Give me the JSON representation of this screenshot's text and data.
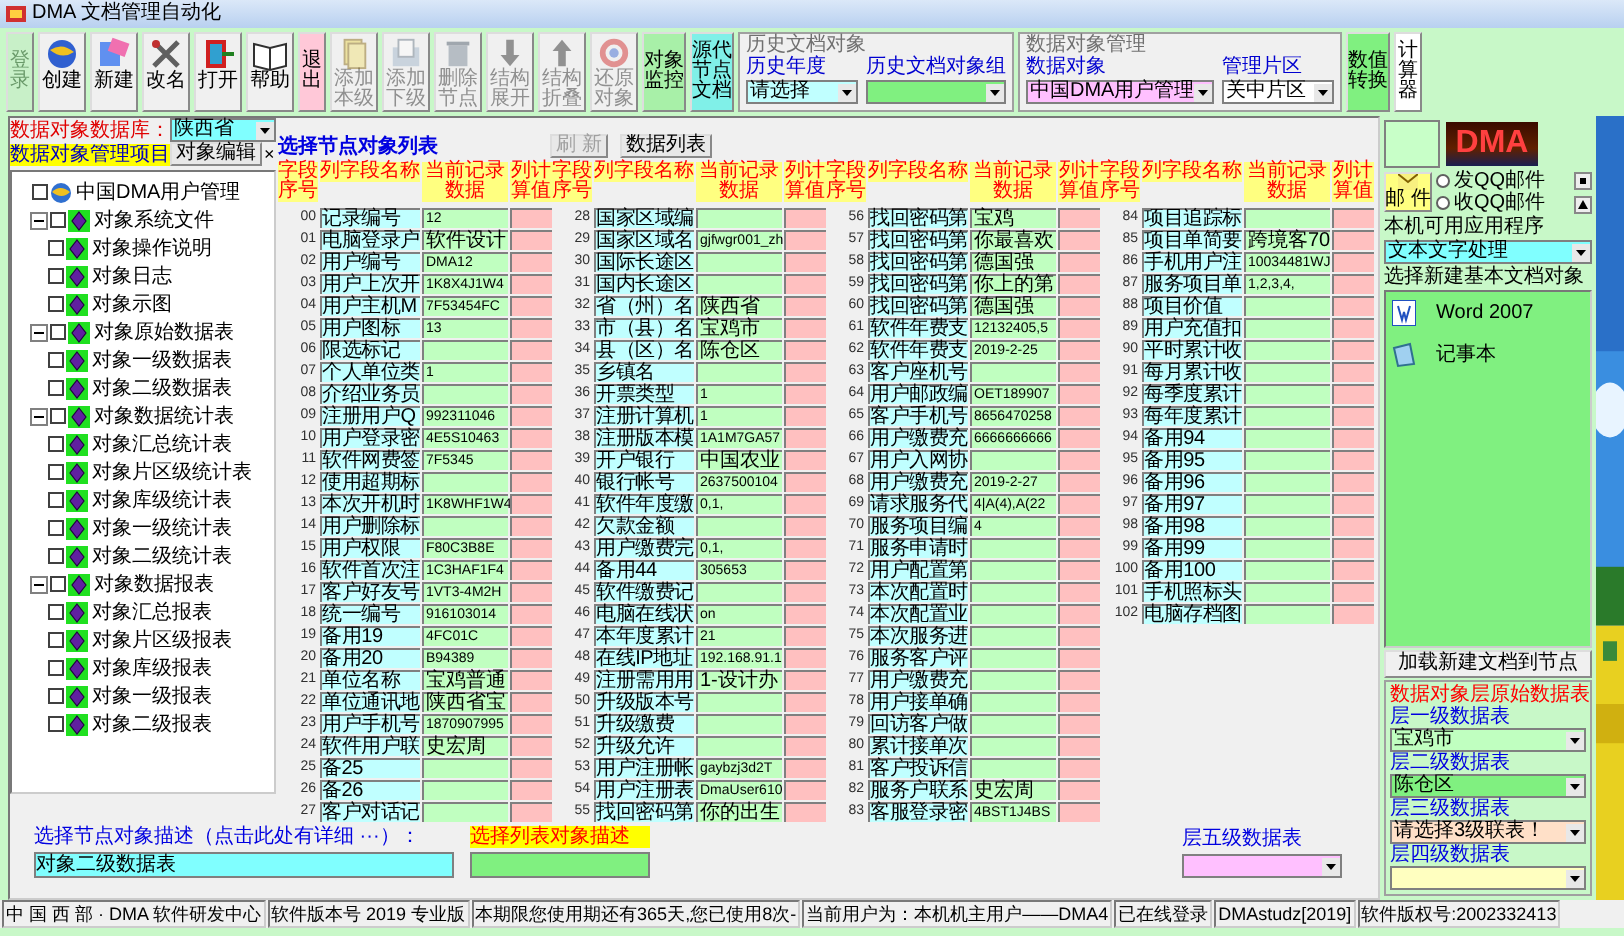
{
  "window": {
    "title": "DMA 文档管理自动化"
  },
  "toolbar": [
    {
      "kind": "tile",
      "label": "登录",
      "disabled": true,
      "color": "#c8f0c8"
    },
    {
      "kind": "icon",
      "label": "创建",
      "disabled": false
    },
    {
      "kind": "icon",
      "label": "新建",
      "disabled": false
    },
    {
      "kind": "icon",
      "label": "改名",
      "disabled": false
    },
    {
      "kind": "icon",
      "label": "打开",
      "disabled": false
    },
    {
      "kind": "icon",
      "label": "帮助",
      "disabled": false
    },
    {
      "kind": "tile",
      "label": "退出",
      "disabled": false,
      "color": "#ffc8d8"
    },
    {
      "kind": "icon",
      "label": "添加本级",
      "disabled": true
    },
    {
      "kind": "icon",
      "label": "添加下级",
      "disabled": true
    },
    {
      "kind": "icon",
      "label": "删除节点",
      "disabled": true
    },
    {
      "kind": "icon",
      "label": "结构展开",
      "disabled": true
    },
    {
      "kind": "icon",
      "label": "结构折叠",
      "disabled": true
    },
    {
      "kind": "icon",
      "label": "还原对象",
      "disabled": true
    },
    {
      "kind": "tile",
      "label": "对象监控",
      "disabled": false,
      "color": "#a8f0a8"
    },
    {
      "kind": "tile",
      "label": "源代节点文档",
      "disabled": false,
      "color": "#80f0e8"
    },
    {
      "kind": "group",
      "title": "历史文档对象",
      "fields": [
        {
          "label": "历史年度",
          "value": "请选择",
          "color": "#c0ffff"
        },
        {
          "label": "历史文档对象组",
          "color": "#80f080"
        }
      ]
    },
    {
      "kind": "group",
      "title": "数据对象管理",
      "fields": [
        {
          "label": "数据对象",
          "value": "中国DMA用户管理",
          "color": "#ffc0ff"
        },
        {
          "label": "管理片区",
          "value": "关中片区",
          "color": "#ffffff"
        }
      ]
    },
    {
      "kind": "tile",
      "label": "数值转换",
      "disabled": false,
      "color": "#80f080"
    },
    {
      "kind": "tile",
      "label": "计算器",
      "disabled": false,
      "color": "#ffffff"
    }
  ],
  "left": {
    "database_label": "数据对象数据库：",
    "database": "陕西省",
    "project_label": "数据对象管理项目",
    "edit_button": "对象编辑",
    "close_button": "×",
    "tree": {
      "label": "中国DMA用户管理",
      "checked": false,
      "children": [
        {
          "label": "对象系统文件",
          "checked": false,
          "expanded": true,
          "children": [
            {
              "label": "对象操作说明",
              "checked": false
            },
            {
              "label": "对象日志",
              "checked": false
            },
            {
              "label": "对象示图",
              "checked": false
            }
          ]
        },
        {
          "label": "对象原始数据表",
          "checked": false,
          "expanded": true,
          "children": [
            {
              "label": "对象一级数据表",
              "checked": false
            },
            {
              "label": "对象二级数据表",
              "checked": false
            }
          ]
        },
        {
          "label": "对象数据统计表",
          "checked": false,
          "expanded": true,
          "children": [
            {
              "label": "对象汇总统计表",
              "checked": false
            },
            {
              "label": "对象片区级统计表",
              "checked": false
            },
            {
              "label": "对象库级统计表",
              "checked": false
            },
            {
              "label": "对象一级统计表",
              "checked": false
            },
            {
              "label": "对象二级统计表",
              "checked": false
            }
          ]
        },
        {
          "label": "对象数据报表",
          "checked": false,
          "expanded": true,
          "children": [
            {
              "label": "对象汇总报表",
              "checked": false
            },
            {
              "label": "对象片区级报表",
              "checked": false
            },
            {
              "label": "对象库级报表",
              "checked": false
            },
            {
              "label": "对象一级报表",
              "checked": false
            },
            {
              "label": "对象二级报表",
              "checked": false
            }
          ]
        }
      ]
    }
  },
  "table": {
    "title": "选择节点对象列表",
    "refresh_button": {
      "label": "刷 新",
      "disabled": true
    },
    "list_button": "数据列表",
    "groups": [
      {
        "headers": [
          "字段序号",
          "列字段名称",
          "当前记录数据",
          "列计算值"
        ],
        "rows": [
          {
            "no": "00",
            "name": "记录编号",
            "value": "12"
          },
          {
            "no": "01",
            "name": "电脑登录户",
            "value": "软件设计"
          },
          {
            "no": "02",
            "name": "用户编号",
            "value": "DMA12"
          },
          {
            "no": "03",
            "name": "用户上次开",
            "value": "1K8X4J1W4"
          },
          {
            "no": "04",
            "name": "用户主机M",
            "value": "7F53454FC"
          },
          {
            "no": "05",
            "name": "用户图标",
            "value": "13"
          },
          {
            "no": "06",
            "name": "限选标记"
          },
          {
            "no": "07",
            "name": "个人单位类",
            "value": "1"
          },
          {
            "no": "08",
            "name": "介绍业务员"
          },
          {
            "no": "09",
            "name": "注册用户Q",
            "value": "992311046"
          },
          {
            "no": "10",
            "name": "用户登录密",
            "value": "4E5S10463"
          },
          {
            "no": "11",
            "name": "软件网费签",
            "value": "7F5345"
          },
          {
            "no": "12",
            "name": "使用超期标"
          },
          {
            "no": "13",
            "name": "本次开机时",
            "value": "1K8WHF1W4"
          },
          {
            "no": "14",
            "name": "用户删除标"
          },
          {
            "no": "15",
            "name": "用户权限",
            "value": "F80C3B8E"
          },
          {
            "no": "16",
            "name": "软件首次注",
            "value": "1C3HAF1F4"
          },
          {
            "no": "17",
            "name": "客户好友号",
            "value": "1VT3-4M2H"
          },
          {
            "no": "18",
            "name": "统一编号",
            "value": "916103014"
          },
          {
            "no": "19",
            "name": "备用19",
            "value": "4FC01C"
          },
          {
            "no": "20",
            "name": "备用20",
            "value": "B94389"
          },
          {
            "no": "21",
            "name": "单位名称",
            "value": "宝鸡普通"
          },
          {
            "no": "22",
            "name": "单位通讯地",
            "value": "陕西省宝"
          },
          {
            "no": "23",
            "name": "用户手机号",
            "value": "1870907995"
          },
          {
            "no": "24",
            "name": "软件用户联",
            "value": "史宏周"
          },
          {
            "no": "25",
            "name": "备25"
          },
          {
            "no": "26",
            "name": "备26"
          },
          {
            "no": "27",
            "name": "客户对话记"
          }
        ]
      },
      {
        "headers": [
          "字段序号",
          "列字段名称",
          "当前记录数据",
          "列计算值"
        ],
        "rows": [
          {
            "no": "28",
            "name": "国家区域编"
          },
          {
            "no": "29",
            "name": "国家区域名",
            "value": "gjfwgr001_zh"
          },
          {
            "no": "30",
            "name": "国际长途区"
          },
          {
            "no": "31",
            "name": "国内长途区"
          },
          {
            "no": "32",
            "name": "省（州）名",
            "value": "陕西省"
          },
          {
            "no": "33",
            "name": "市（县）名",
            "value": "宝鸡市"
          },
          {
            "no": "34",
            "name": "县（区）名",
            "value": "陈仓区"
          },
          {
            "no": "35",
            "name": "乡镇名"
          },
          {
            "no": "36",
            "name": "开票类型",
            "value": "1"
          },
          {
            "no": "37",
            "name": "注册计算机",
            "value": "1"
          },
          {
            "no": "38",
            "name": "注册版本模",
            "value": "1A1M7GA57"
          },
          {
            "no": "39",
            "name": "开户银行",
            "value": "中国农业"
          },
          {
            "no": "40",
            "name": "银行帐号",
            "value": "2637500104"
          },
          {
            "no": "41",
            "name": "软件年度缴",
            "value": "0,1,"
          },
          {
            "no": "42",
            "name": "欠款金额"
          },
          {
            "no": "43",
            "name": "用户缴费完",
            "value": "0,1,"
          },
          {
            "no": "44",
            "name": "备用44",
            "value": "305653"
          },
          {
            "no": "45",
            "name": "软件缴费记"
          },
          {
            "no": "46",
            "name": "电脑在线状",
            "value": "on"
          },
          {
            "no": "47",
            "name": "本年度累计",
            "value": "21"
          },
          {
            "no": "48",
            "name": "在线IP地址",
            "value": "192.168.91.1"
          },
          {
            "no": "49",
            "name": "注册需用用",
            "value": "1-设计办"
          },
          {
            "no": "50",
            "name": "升级版本号"
          },
          {
            "no": "51",
            "name": "升级缴费"
          },
          {
            "no": "52",
            "name": "升级允许"
          },
          {
            "no": "53",
            "name": "用户注册帐",
            "value": "gaybzj3d2T"
          },
          {
            "no": "54",
            "name": "用户注册表",
            "value": "DmaUser610"
          },
          {
            "no": "55",
            "name": "找回密码第",
            "value": "你的出生"
          }
        ]
      },
      {
        "headers": [
          "字段序号",
          "列字段名称",
          "当前记录数据",
          "列计算值"
        ],
        "rows": [
          {
            "no": "56",
            "name": "找回密码第",
            "value": "宝鸡"
          },
          {
            "no": "57",
            "name": "找回密码第",
            "value": "你最喜欢"
          },
          {
            "no": "58",
            "name": "找回密码第",
            "value": "德国强"
          },
          {
            "no": "59",
            "name": "找回密码第",
            "value": "你上的第"
          },
          {
            "no": "60",
            "name": "找回密码第",
            "value": "德国强"
          },
          {
            "no": "61",
            "name": "软件年费支",
            "value": "12132405,5"
          },
          {
            "no": "62",
            "name": "软件年费支",
            "value": "2019-2-25"
          },
          {
            "no": "63",
            "name": "客户座机号"
          },
          {
            "no": "64",
            "name": "用户邮政编",
            "value": "OET189907"
          },
          {
            "no": "65",
            "name": "客户手机号",
            "value": "8656470258"
          },
          {
            "no": "66",
            "name": "用户缴费充",
            "value": "6666666666"
          },
          {
            "no": "67",
            "name": "用户入网协"
          },
          {
            "no": "68",
            "name": "用户缴费充",
            "value": "2019-2-27"
          },
          {
            "no": "69",
            "name": "请求服务代",
            "value": "4|A(4),A(22"
          },
          {
            "no": "70",
            "name": "服务项目编",
            "value": "4"
          },
          {
            "no": "71",
            "name": "服务申请时"
          },
          {
            "no": "72",
            "name": "用户配置第"
          },
          {
            "no": "73",
            "name": "本次配置时"
          },
          {
            "no": "74",
            "name": "本次配置业"
          },
          {
            "no": "75",
            "name": "本次服务进"
          },
          {
            "no": "76",
            "name": "服务客户评"
          },
          {
            "no": "77",
            "name": "用户缴费充"
          },
          {
            "no": "78",
            "name": "用户接单确"
          },
          {
            "no": "79",
            "name": "回访客户做"
          },
          {
            "no": "80",
            "name": "累计接单次"
          },
          {
            "no": "81",
            "name": "客户投诉信"
          },
          {
            "no": "82",
            "name": "服务户联系",
            "value": "史宏周"
          },
          {
            "no": "83",
            "name": "客服登录密",
            "value": "4BST1J4BS"
          }
        ]
      },
      {
        "headers": [
          "字段序号",
          "列字段名称",
          "当前记录数据",
          "列计算值"
        ],
        "rows": [
          {
            "no": "84",
            "name": "项目追踪标"
          },
          {
            "no": "85",
            "name": "项目单简要",
            "value": "跨境客70"
          },
          {
            "no": "86",
            "name": "手机用户注",
            "value": "10034481WJ"
          },
          {
            "no": "87",
            "name": "服务项目单",
            "value": "1,2,3,4,"
          },
          {
            "no": "88",
            "name": "项目价值"
          },
          {
            "no": "89",
            "name": "用户充值扣"
          },
          {
            "no": "90",
            "name": "平时累计收"
          },
          {
            "no": "91",
            "name": "每月累计收"
          },
          {
            "no": "92",
            "name": "每季度累计"
          },
          {
            "no": "93",
            "name": "每年度累计"
          },
          {
            "no": "94",
            "name": "备用94"
          },
          {
            "no": "95",
            "name": "备用95"
          },
          {
            "no": "96",
            "name": "备用96"
          },
          {
            "no": "97",
            "name": "备用97"
          },
          {
            "no": "98",
            "name": "备用98"
          },
          {
            "no": "99",
            "name": "备用99"
          },
          {
            "no": "100",
            "name": "备用100"
          },
          {
            "no": "101",
            "name": "手机照标头"
          },
          {
            "no": "102",
            "name": "电脑存档图"
          }
        ]
      }
    ]
  },
  "bottom": {
    "node_description_label": "选择节点对象描述（点击此处有详细 ···）：",
    "node_description": "对象二级数据表",
    "list_description_label": "选择列表对象描述",
    "level5_label": "层五级数据表"
  },
  "right": {
    "logo": "DMA",
    "mail_button": "邮 件",
    "radios": [
      {
        "label": "发QQ邮件",
        "selected": false
      },
      {
        "label": "收QQ邮件",
        "selected": false
      }
    ],
    "apps_label": "本机可用应用程序",
    "apps": "文本文字处理",
    "new_doc_label": "选择新建基本文档对象",
    "docs": [
      "Word 2007",
      "记事本"
    ],
    "load_button": "加载新建文档到节点",
    "levels_title": "数据对象层原始数据表",
    "levels": [
      {
        "label": "层一级数据表",
        "value": "宝鸡市",
        "color": "#c0ffc0"
      },
      {
        "label": "层二级数据表",
        "value": "陈仓区",
        "color": "#80f080"
      },
      {
        "label": "层三级数据表",
        "value": "请选择3级联表！",
        "color": "#ffe0c8"
      },
      {
        "label": "层四级数据表",
        "color": "#ffffc0"
      }
    ]
  },
  "status_bar": [
    "中 国 西 部 · DMA 软件研发中心",
    "软件版本号 2019 专业版",
    "本期限您使用期还有365天,您已使用8次-",
    "当前用户为：本机机主用户——DMA4",
    "已在线登录",
    "DMAstudz[2019]",
    "软件版权号:2002332413"
  ]
}
